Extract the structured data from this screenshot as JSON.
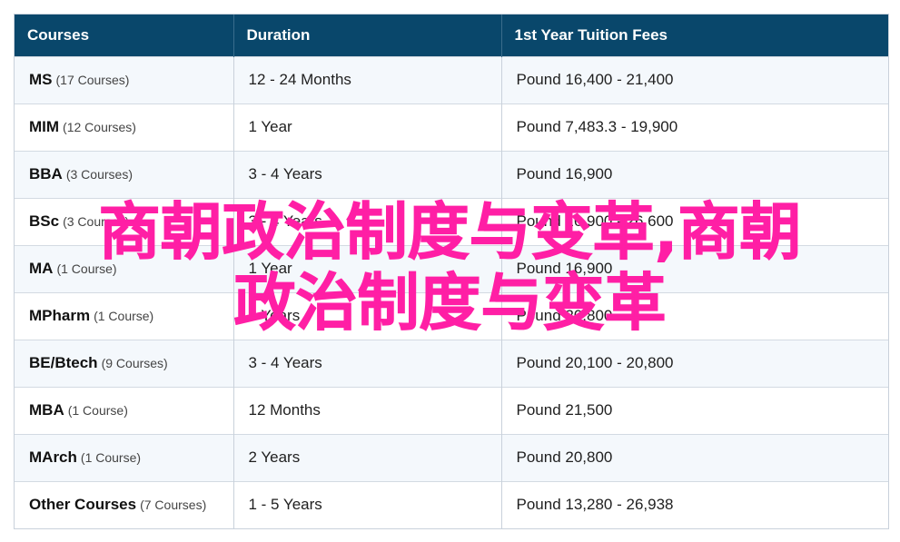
{
  "table": {
    "headers": [
      "Courses",
      "Duration",
      "1st Year Tuition Fees"
    ],
    "rows": [
      {
        "name": "MS",
        "count": "(17 Courses)",
        "duration": "12 - 24 Months",
        "fees": "Pound 16,400 - 21,400"
      },
      {
        "name": "MIM",
        "count": "(12 Courses)",
        "duration": "1 Year",
        "fees": "Pound 7,483.3 - 19,900"
      },
      {
        "name": "BBA",
        "count": "(3 Courses)",
        "duration": "3 - 4 Years",
        "fees": "Pound 16,900"
      },
      {
        "name": "BSc",
        "count": "(3 Courses)",
        "duration": "3 - 4 Years",
        "fees": "Pound 16,900 - 26,600"
      },
      {
        "name": "MA",
        "count": "(1 Course)",
        "duration": "1 Year",
        "fees": "Pound 16,900"
      },
      {
        "name": "MPharm",
        "count": "(1 Course)",
        "duration": "4 Years",
        "fees": "Pound 20,800"
      },
      {
        "name": "BE/Btech",
        "count": "(9 Courses)",
        "duration": "3 - 4 Years",
        "fees": "Pound 20,100 - 20,800"
      },
      {
        "name": "MBA",
        "count": "(1 Course)",
        "duration": "12 Months",
        "fees": "Pound 21,500"
      },
      {
        "name": "MArch",
        "count": "(1 Course)",
        "duration": "2 Years",
        "fees": "Pound 20,800"
      },
      {
        "name": "Other Courses",
        "count": "(7 Courses)",
        "duration": "1 - 5 Years",
        "fees": "Pound 13,280 - 26,938"
      }
    ]
  },
  "watermark": {
    "line1": "商朝政治制度与变革,商朝",
    "line2": "政治制度与变革",
    "color": "#ff1fa5"
  },
  "colors": {
    "header_bg": "#09476b",
    "row_alt_bg": "#f4f8fc"
  }
}
